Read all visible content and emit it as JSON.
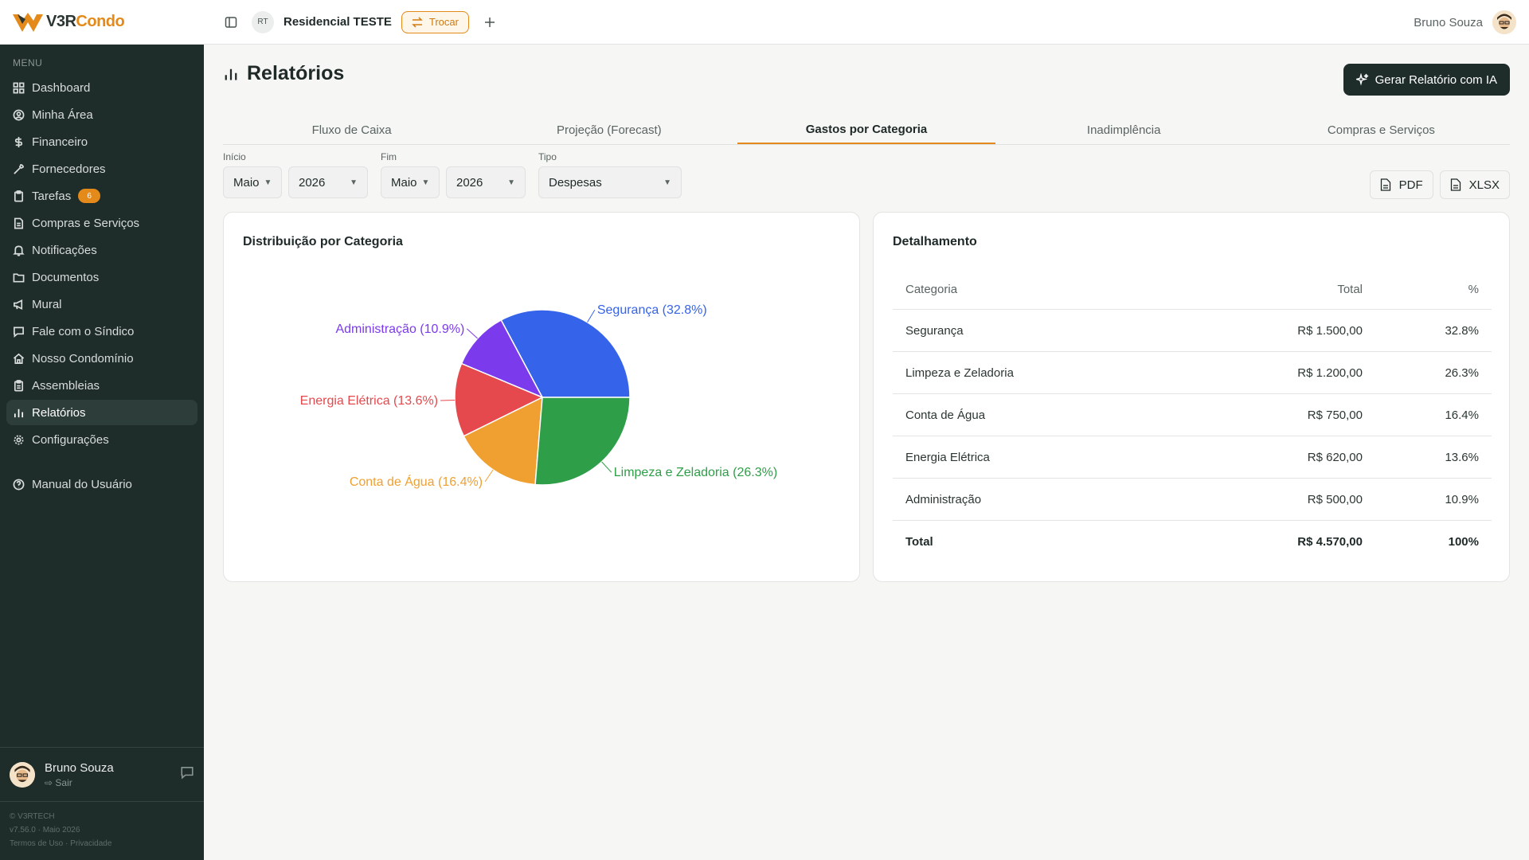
{
  "brand": {
    "name_part1": "V3R",
    "name_part2": "Condo",
    "accent": "#e38a1a",
    "dark": "#1f2d2a"
  },
  "topbar": {
    "condo_initials": "RT",
    "condo_name": "Residencial TESTE",
    "switch_label": "Trocar",
    "user_name": "Bruno Souza"
  },
  "sidebar": {
    "menu_label": "MENU",
    "items": [
      {
        "label": "Dashboard",
        "icon": "grid-icon"
      },
      {
        "label": "Minha Área",
        "icon": "user-circle-icon"
      },
      {
        "label": "Financeiro",
        "icon": "dollar-icon"
      },
      {
        "label": "Fornecedores",
        "icon": "wrench-icon"
      },
      {
        "label": "Tarefas",
        "icon": "clipboard-icon",
        "badge": "6"
      },
      {
        "label": "Compras e Serviços",
        "icon": "file-icon"
      },
      {
        "label": "Notificações",
        "icon": "bell-icon"
      },
      {
        "label": "Documentos",
        "icon": "folder-icon"
      },
      {
        "label": "Mural",
        "icon": "megaphone-icon"
      },
      {
        "label": "Fale com o Síndico",
        "icon": "chat-icon"
      },
      {
        "label": "Nosso Condomínio",
        "icon": "home-icon"
      },
      {
        "label": "Assembleias",
        "icon": "clipboard-list-icon"
      },
      {
        "label": "Relatórios",
        "icon": "bar-chart-icon",
        "active": true
      },
      {
        "label": "Configurações",
        "icon": "gear-icon"
      }
    ],
    "help_item": "Manual do Usuário",
    "user": {
      "name": "Bruno Souza",
      "logout": "Sair"
    },
    "footer": {
      "company": "© V3RTECH",
      "version": "v7.56.0 · Maio 2026",
      "terms": "Termos de Uso",
      "separator": "·",
      "privacy": "Privacidade"
    }
  },
  "page": {
    "title": "Relatórios",
    "ai_button": "Gerar Relatório com IA",
    "tabs": [
      "Fluxo de Caixa",
      "Projeção (Forecast)",
      "Gastos por Categoria",
      "Inadimplência",
      "Compras e Serviços"
    ],
    "active_tab": 2,
    "filters": {
      "start_label": "Início",
      "start_month": "Maio",
      "start_year": "2026",
      "end_label": "Fim",
      "end_month": "Maio",
      "end_year": "2026",
      "type_label": "Tipo",
      "type_value": "Despesas"
    },
    "exports": {
      "pdf": "PDF",
      "xlsx": "XLSX"
    }
  },
  "chart_card": {
    "title": "Distribuição por Categoria"
  },
  "chart_data": {
    "type": "pie",
    "categories": [
      "Segurança",
      "Administração",
      "Energia Elétrica",
      "Conta de Água",
      "Limpeza e Zeladoria"
    ],
    "values": [
      32.8,
      10.9,
      13.6,
      16.4,
      26.3
    ],
    "labels": [
      "Segurança (32.8%)",
      "Administração (10.9%)",
      "Energia Elétrica (13.6%)",
      "Conta de Água (16.4%)",
      "Limpeza e Zeladoria (26.3%)"
    ],
    "colors": [
      "#3563e9",
      "#7c3aed",
      "#e5484d",
      "#f0a030",
      "#2e9e48"
    ]
  },
  "table_card": {
    "title": "Detalhamento",
    "headers": {
      "category": "Categoria",
      "total": "Total",
      "percent": "%"
    },
    "rows": [
      {
        "category": "Segurança",
        "total": "R$ 1.500,00",
        "percent": "32.8%"
      },
      {
        "category": "Limpeza e Zeladoria",
        "total": "R$ 1.200,00",
        "percent": "26.3%"
      },
      {
        "category": "Conta de Água",
        "total": "R$ 750,00",
        "percent": "16.4%"
      },
      {
        "category": "Energia Elétrica",
        "total": "R$ 620,00",
        "percent": "13.6%"
      },
      {
        "category": "Administração",
        "total": "R$ 500,00",
        "percent": "10.9%"
      }
    ],
    "total": {
      "label": "Total",
      "total": "R$ 4.570,00",
      "percent": "100%"
    }
  }
}
